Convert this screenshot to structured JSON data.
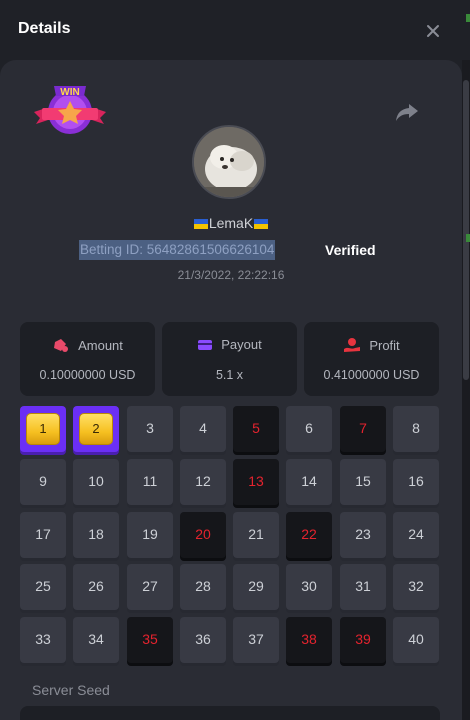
{
  "header": {
    "title": "Details"
  },
  "player": {
    "name": "LemaK",
    "betting_id": "Betting ID: 5648286150662610‌4",
    "verified": "Verified",
    "timestamp": "21/3/2022, 22:22:16"
  },
  "stats": {
    "amount": {
      "label": "Amount",
      "value": "0.10000000 USD"
    },
    "payout": {
      "label": "Payout",
      "value": "5.1 x"
    },
    "profit": {
      "label": "Profit",
      "value": "0.41000000 USD"
    }
  },
  "grid": {
    "numbers": [
      1,
      2,
      3,
      4,
      5,
      6,
      7,
      8,
      9,
      10,
      11,
      12,
      13,
      14,
      15,
      16,
      17,
      18,
      19,
      20,
      21,
      22,
      23,
      24,
      25,
      26,
      27,
      28,
      29,
      30,
      31,
      32,
      33,
      34,
      35,
      36,
      37,
      38,
      39,
      40
    ],
    "selected": [
      1,
      2
    ],
    "drawn": [
      5,
      7,
      13,
      20,
      22,
      35,
      38,
      39
    ]
  },
  "server_seed": {
    "label": "Server Seed"
  },
  "icons": {
    "close": "close-icon",
    "share": "share-icon",
    "badge": "win-badge-icon",
    "amount": "money-bag-icon",
    "payout": "card-icon",
    "profit": "hand-coin-icon"
  },
  "colors": {
    "accent": "#6b2ff5",
    "hit": "#e4232e",
    "gem": "#f6c021"
  }
}
